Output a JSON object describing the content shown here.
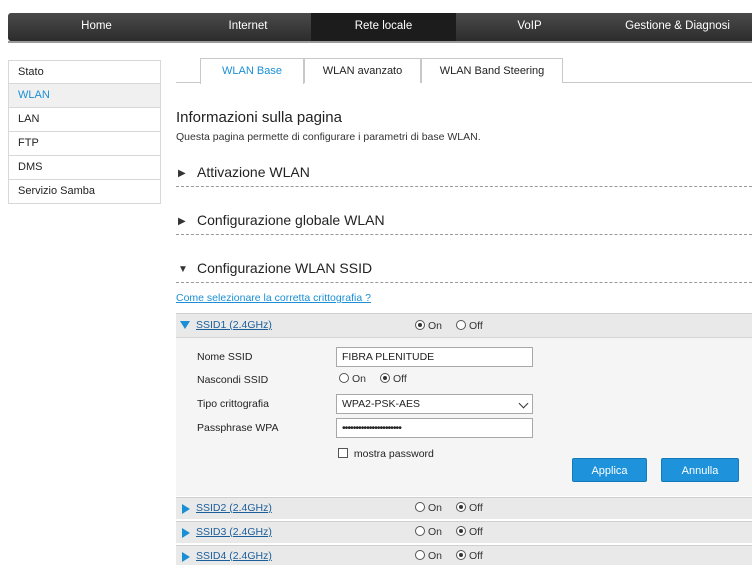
{
  "topnav": {
    "items": [
      {
        "label": "Home"
      },
      {
        "label": "Internet"
      },
      {
        "label": "Rete locale"
      },
      {
        "label": "VoIP"
      },
      {
        "label": "Gestione & Diagnosi"
      }
    ],
    "active": "Rete locale"
  },
  "sidebar": {
    "items": [
      {
        "label": "Stato"
      },
      {
        "label": "WLAN"
      },
      {
        "label": "LAN"
      },
      {
        "label": "FTP"
      },
      {
        "label": "DMS"
      },
      {
        "label": "Servizio Samba"
      }
    ],
    "active": "WLAN"
  },
  "tabs": [
    {
      "label": "WLAN Base"
    },
    {
      "label": "WLAN avanzato"
    },
    {
      "label": "WLAN Band Steering"
    }
  ],
  "page": {
    "title": "Informazioni sulla pagina",
    "description": "Questa pagina permette di configurare i parametri di base WLAN."
  },
  "sections": [
    {
      "label": "Attivazione WLAN",
      "expanded": false
    },
    {
      "label": "Configurazione globale WLAN",
      "expanded": false
    },
    {
      "label": "Configurazione WLAN SSID",
      "expanded": true
    }
  ],
  "encryption_help_link": "Come selezionare la corretta crittografia ?",
  "radio_labels": {
    "on": "On",
    "off": "Off"
  },
  "ssids": [
    {
      "name": "SSID1 (2.4GHz)",
      "state": "On",
      "expanded": true
    },
    {
      "name": "SSID2 (2.4GHz)",
      "state": "Off",
      "expanded": false
    },
    {
      "name": "SSID3 (2.4GHz)",
      "state": "Off",
      "expanded": false
    },
    {
      "name": "SSID4 (2.4GHz)",
      "state": "Off",
      "expanded": false
    }
  ],
  "ssid1_form": {
    "ssid_name_label": "Nome SSID",
    "ssid_name_value": "FIBRA PLENITUDE",
    "hide_ssid_label": "Nascondi SSID",
    "hide_ssid_value": "Off",
    "encryption_label": "Tipo crittografia",
    "encryption_value": "WPA2-PSK-AES",
    "passphrase_label": "Passphrase WPA",
    "passphrase_value": "••••••••••••••••••••••",
    "show_password_label": "mostra password",
    "apply_label": "Applica",
    "cancel_label": "Annulla"
  },
  "colors": {
    "accent": "#1a8fd6",
    "nav_bg": "#333333",
    "button": "#1e92da"
  }
}
